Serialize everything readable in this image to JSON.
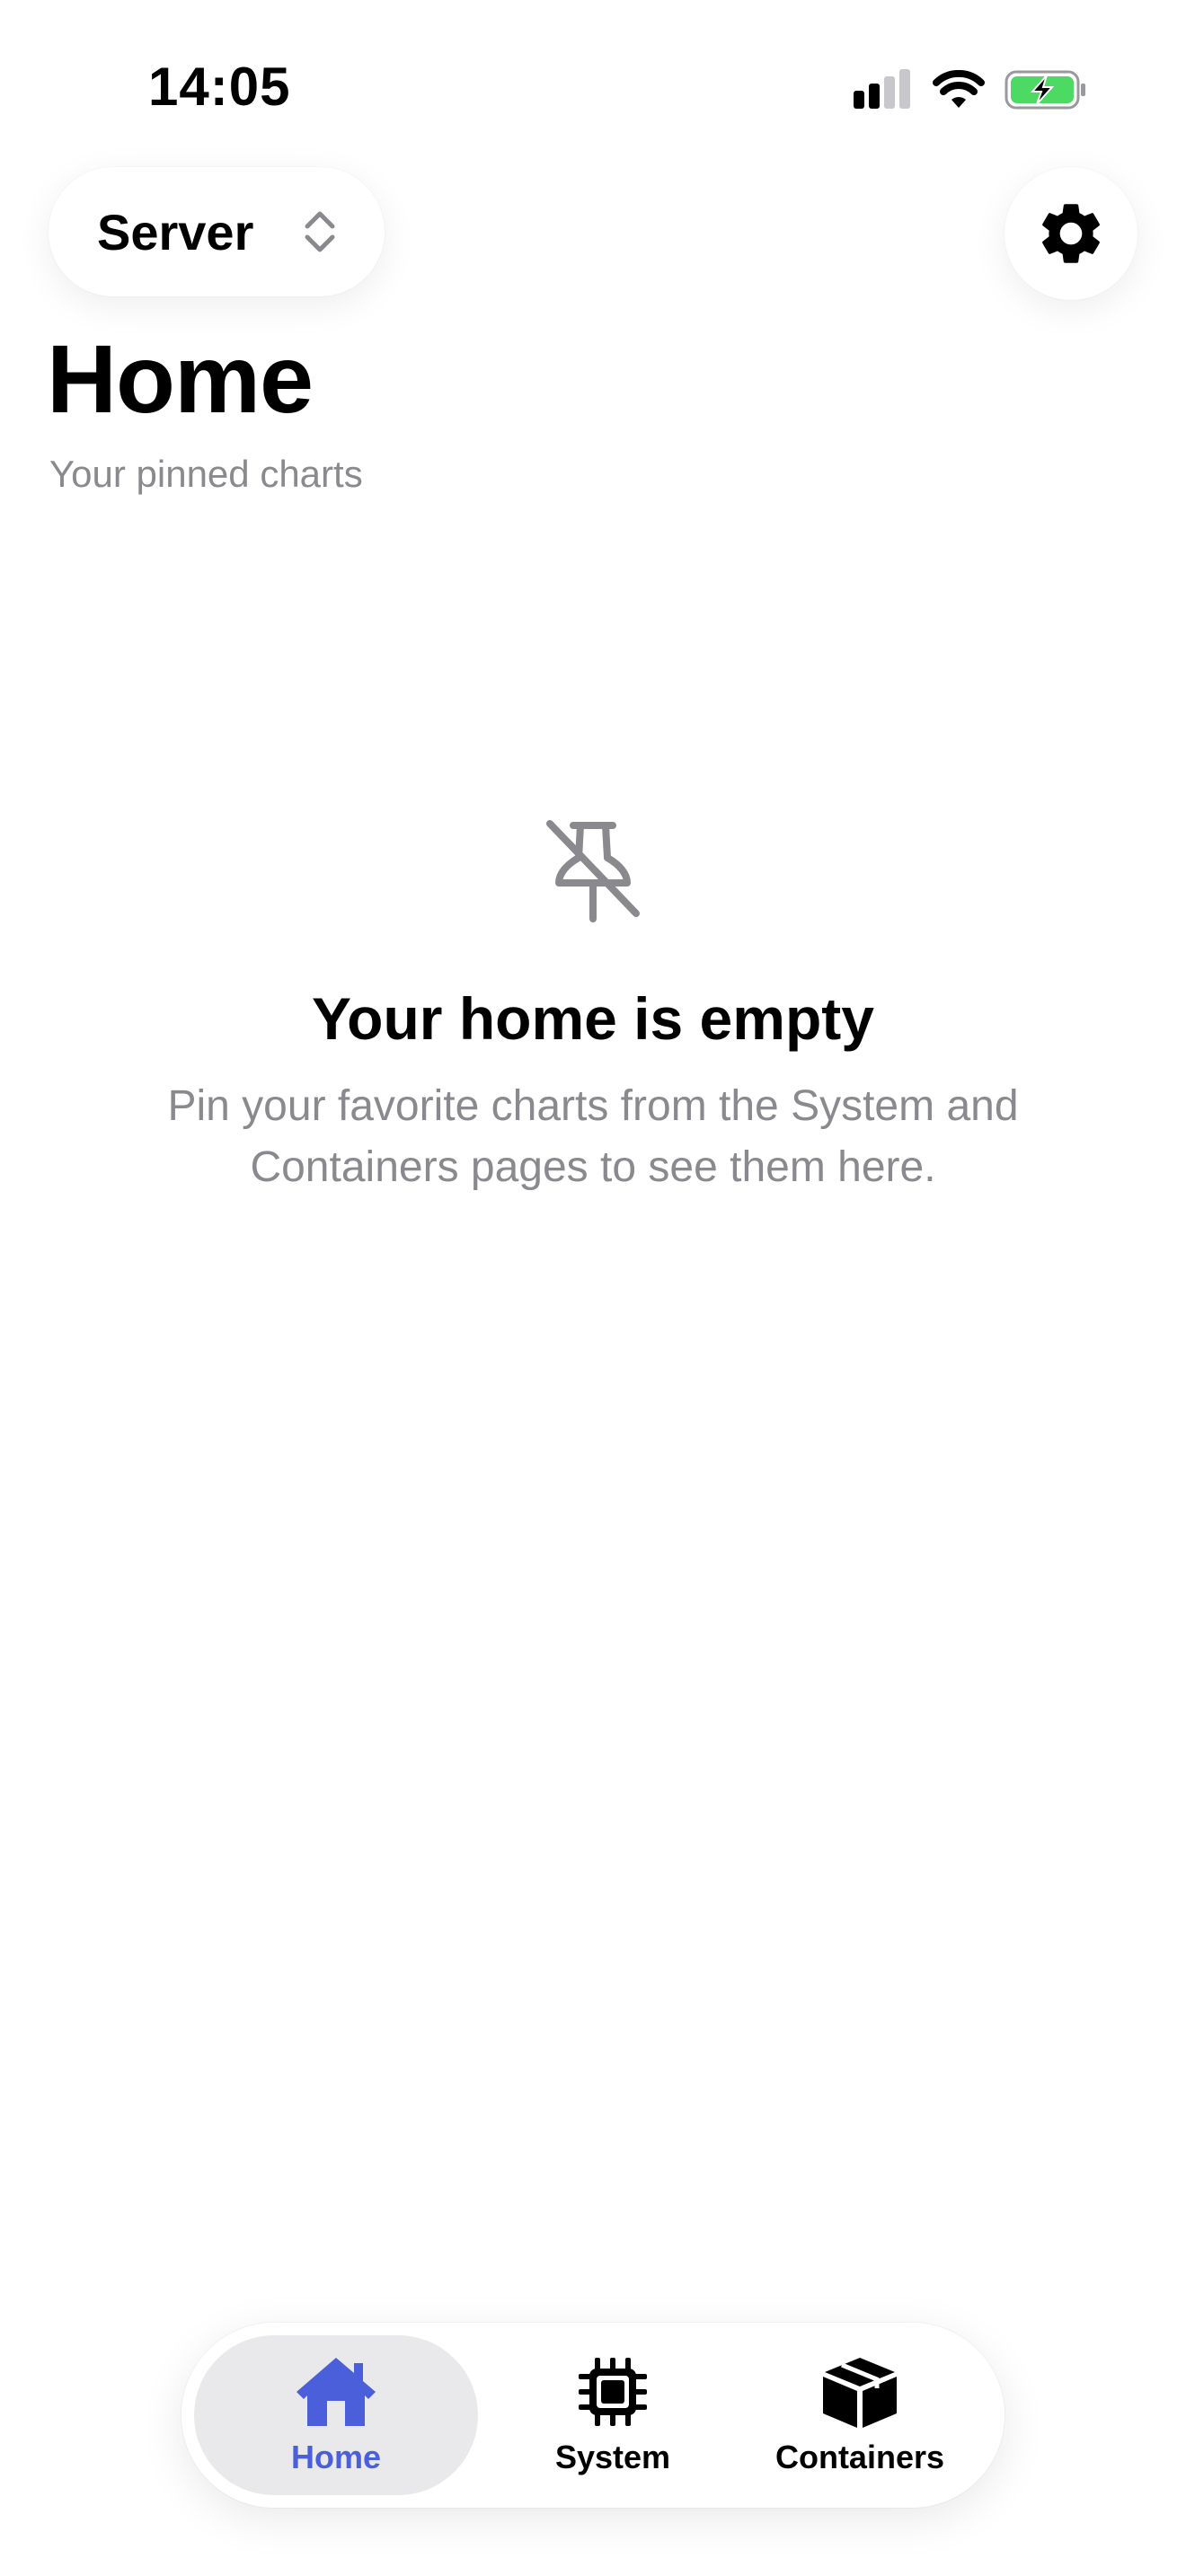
{
  "status_bar": {
    "time": "14:05",
    "icons": [
      "cellular-signal-icon",
      "wifi-icon",
      "battery-charging-icon"
    ]
  },
  "header": {
    "server_selector_label": "Server",
    "server_selector_icon": "chevron-up-down-icon",
    "settings_icon": "gear-icon"
  },
  "page": {
    "title": "Home",
    "subtitle": "Your pinned charts"
  },
  "empty_state": {
    "icon": "pin-slash-icon",
    "title": "Your home is empty",
    "message": "Pin your favorite charts from the System and Containers pages to see them here."
  },
  "tab_bar": {
    "items": [
      {
        "label": "Home",
        "icon": "house-icon",
        "selected": true
      },
      {
        "label": "System",
        "icon": "cpu-icon",
        "selected": false
      },
      {
        "label": "Containers",
        "icon": "shipping-box-icon",
        "selected": false
      }
    ]
  },
  "colors": {
    "accent": "#4a5fd9",
    "secondary_text": "#8a8a8e",
    "selected_tab_background": "#e9e9eb",
    "battery_green": "#4cd964"
  }
}
